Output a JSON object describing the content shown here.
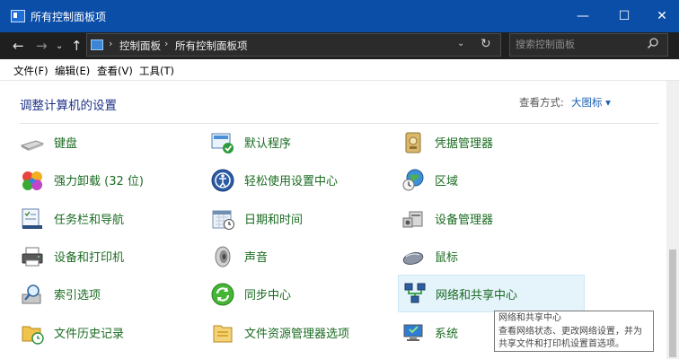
{
  "window": {
    "title": "所有控制面板项",
    "buttons": {
      "minimize": "—",
      "maximize": "☐",
      "close": "✕"
    }
  },
  "navigation": {
    "back_icon": "arrow-left-icon",
    "forward_icon": "arrow-right-icon",
    "recent_icon": "chevron-down-icon",
    "up_icon": "arrow-up-icon",
    "breadcrumb": [
      "控制面板",
      "所有控制面板项"
    ],
    "separator": "›",
    "dropdown_glyph": "⌄",
    "refresh_glyph": "↻"
  },
  "search": {
    "placeholder": "搜索控制面板",
    "value": ""
  },
  "menu": [
    "文件(F)",
    "编辑(E)",
    "查看(V)",
    "工具(T)"
  ],
  "content": {
    "heading": "调整计算机的设置",
    "view_by_label": "查看方式:",
    "view_by_value": "大图标 ▾"
  },
  "items": [
    {
      "label": "键盘",
      "icon": "keyboard-icon"
    },
    {
      "label": "默认程序",
      "icon": "default-programs-icon"
    },
    {
      "label": "凭据管理器",
      "icon": "credential-manager-icon"
    },
    {
      "label": "强力卸载 (32 位)",
      "icon": "uninstaller-icon"
    },
    {
      "label": "轻松使用设置中心",
      "icon": "ease-of-access-icon"
    },
    {
      "label": "区域",
      "icon": "region-icon"
    },
    {
      "label": "任务栏和导航",
      "icon": "taskbar-icon"
    },
    {
      "label": "日期和时间",
      "icon": "date-time-icon"
    },
    {
      "label": "设备管理器",
      "icon": "device-manager-icon"
    },
    {
      "label": "设备和打印机",
      "icon": "printer-icon"
    },
    {
      "label": "声音",
      "icon": "speaker-icon"
    },
    {
      "label": "鼠标",
      "icon": "mouse-icon"
    },
    {
      "label": "索引选项",
      "icon": "indexing-icon"
    },
    {
      "label": "同步中心",
      "icon": "sync-icon"
    },
    {
      "label": "网络和共享中心",
      "icon": "network-icon"
    },
    {
      "label": "文件历史记录",
      "icon": "file-history-icon"
    },
    {
      "label": "文件资源管理器选项",
      "icon": "folder-options-icon"
    },
    {
      "label": "系统",
      "icon": "system-icon"
    }
  ],
  "tooltip": {
    "lines": [
      "网络和共享中心",
      "查看网络状态、更改网络设置，并为",
      "共享文件和打印机设置首选项。"
    ]
  },
  "colors": {
    "titlebar": "#0b4ea8",
    "navbar": "#1f1f1f",
    "link": "#1a6b21",
    "heading": "#1e3287",
    "hover": "#e5f3fb"
  }
}
